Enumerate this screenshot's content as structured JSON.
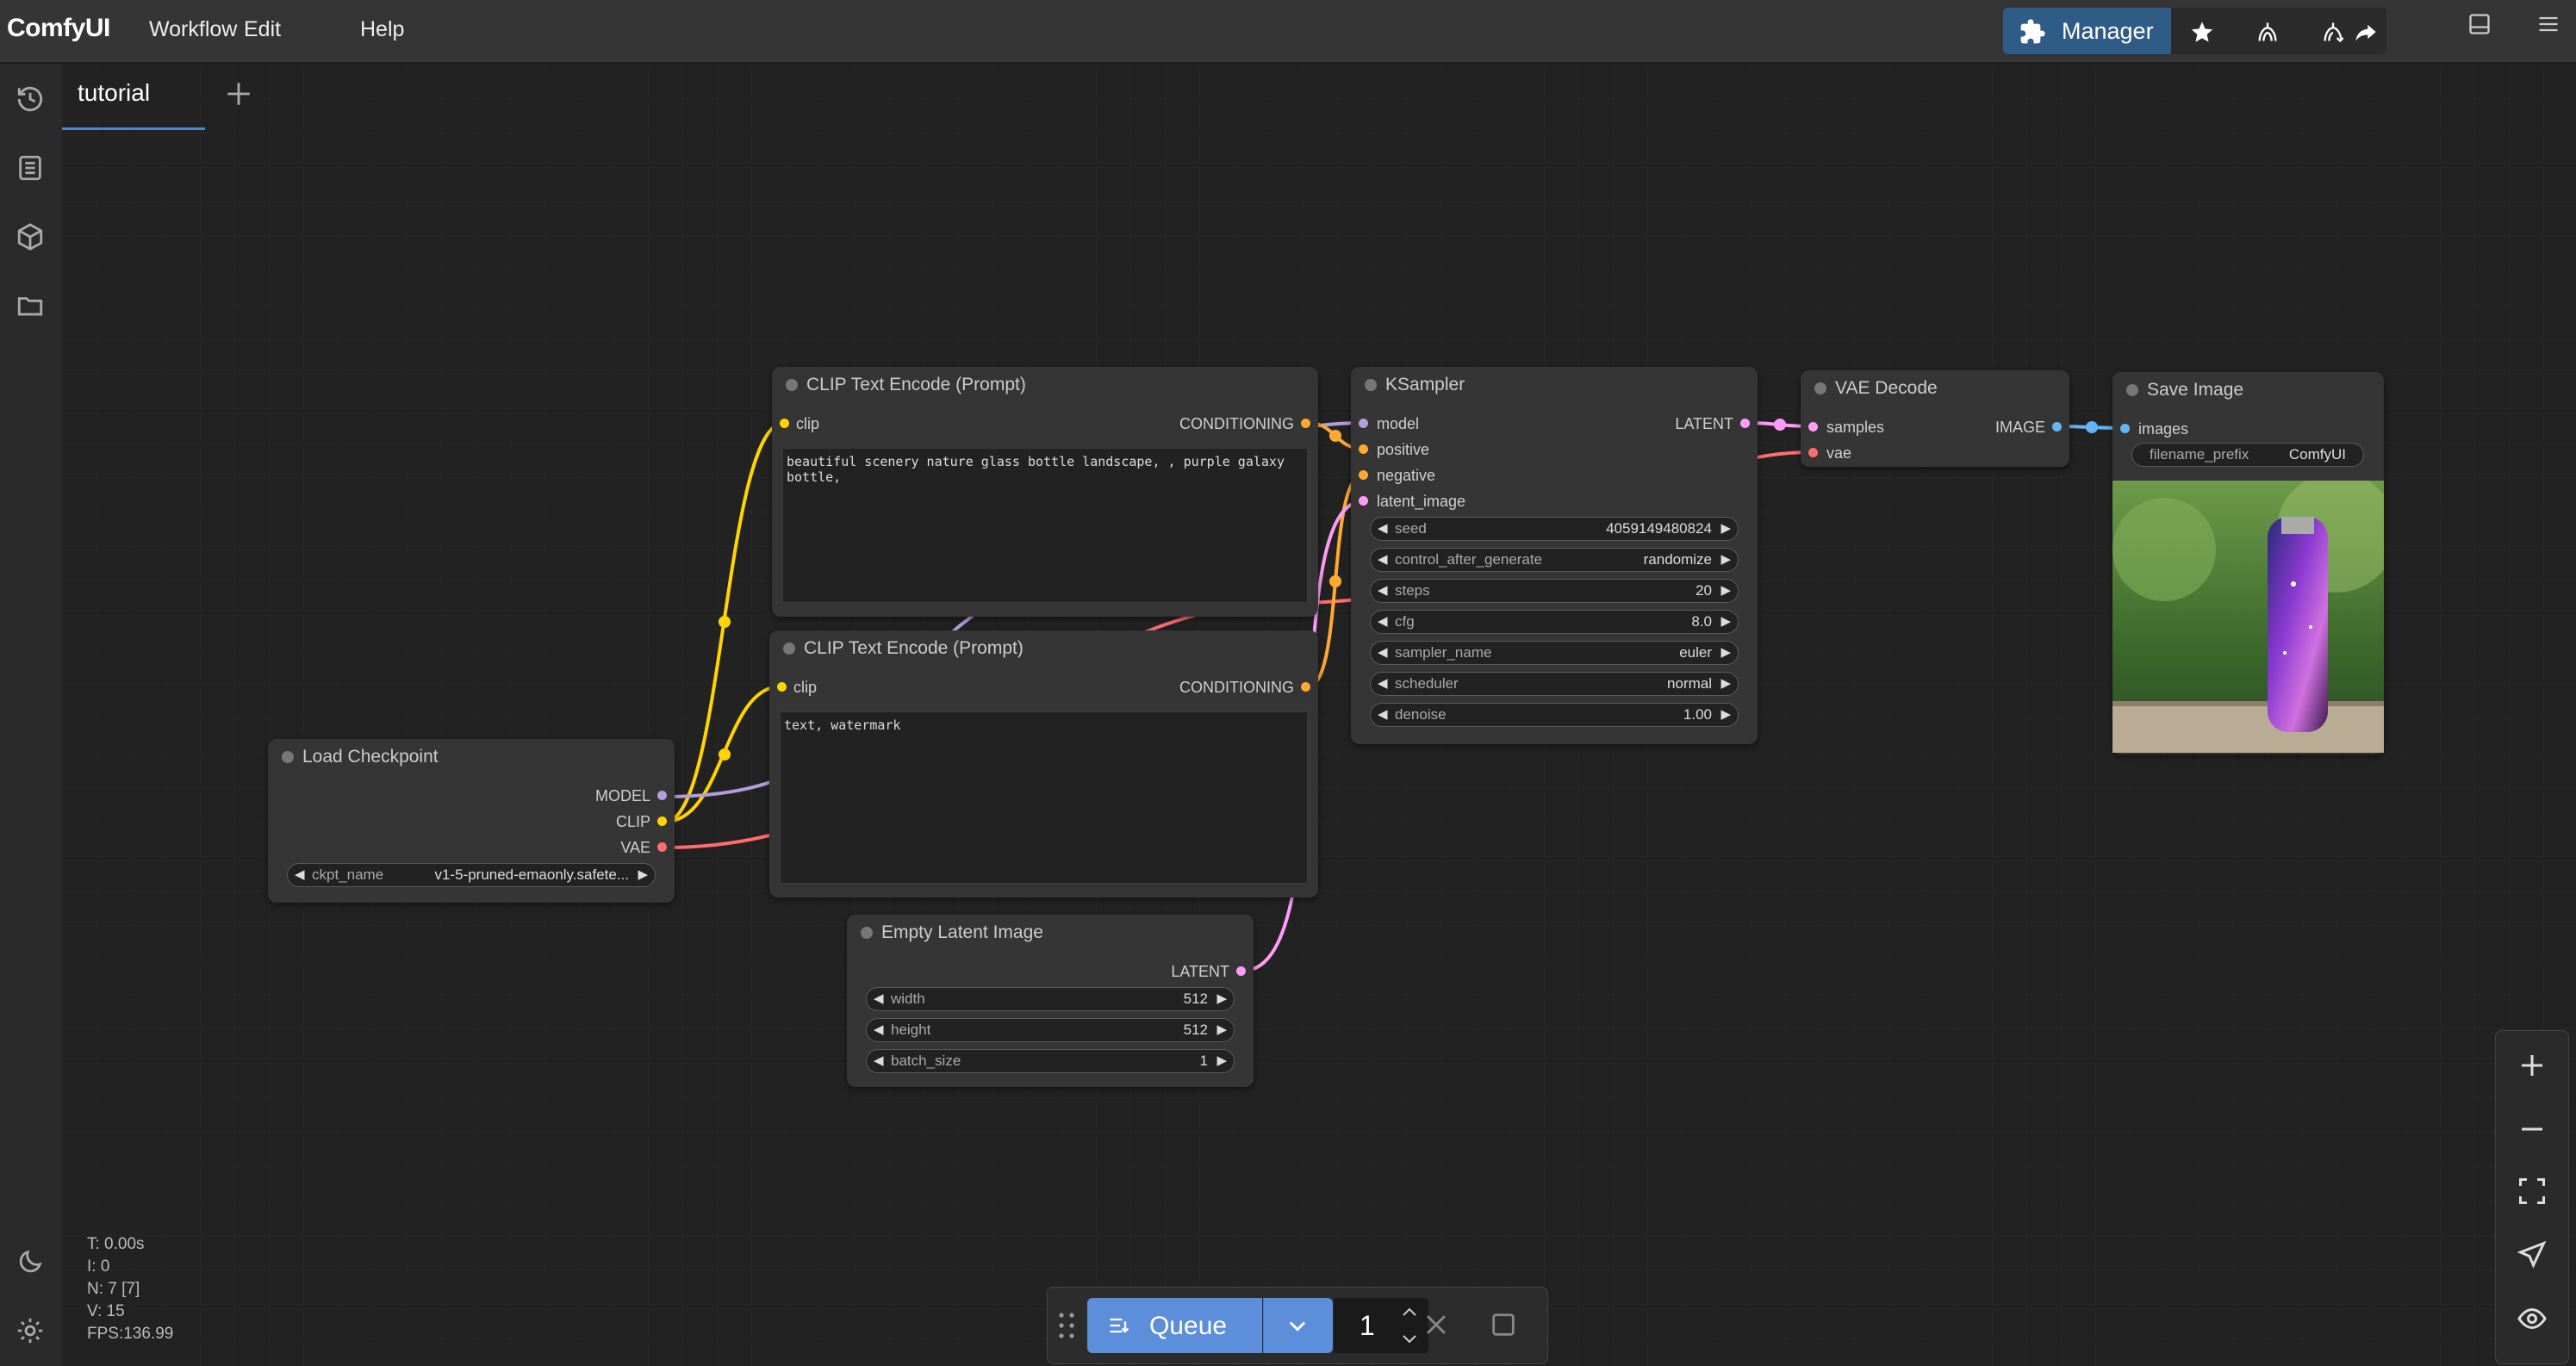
{
  "app": {
    "title": "ComfyUI"
  },
  "menu": {
    "workflow": "Workflow",
    "edit": "Edit",
    "help": "Help"
  },
  "toolbar": {
    "manager_label": "Manager"
  },
  "tabs": [
    {
      "label": "tutorial"
    }
  ],
  "nodes": {
    "clip_pos": {
      "title": "CLIP Text Encode (Prompt)",
      "input": "clip",
      "output": "CONDITIONING",
      "text": "beautiful scenery nature glass bottle landscape, , purple galaxy bottle,"
    },
    "clip_neg": {
      "title": "CLIP Text Encode (Prompt)",
      "input": "clip",
      "output": "CONDITIONING",
      "text": "text, watermark"
    },
    "ksampler": {
      "title": "KSampler",
      "inputs": [
        "model",
        "positive",
        "negative",
        "latent_image"
      ],
      "output": "LATENT",
      "widgets": [
        {
          "label": "seed",
          "value": "4059149480824"
        },
        {
          "label": "control_after_generate",
          "value": "randomize"
        },
        {
          "label": "steps",
          "value": "20"
        },
        {
          "label": "cfg",
          "value": "8.0"
        },
        {
          "label": "sampler_name",
          "value": "euler"
        },
        {
          "label": "scheduler",
          "value": "normal"
        },
        {
          "label": "denoise",
          "value": "1.00"
        }
      ]
    },
    "vae_decode": {
      "title": "VAE Decode",
      "inputs": [
        "samples",
        "vae"
      ],
      "output": "IMAGE"
    },
    "save_image": {
      "title": "Save Image",
      "input": "images",
      "widget": {
        "label": "filename_prefix",
        "value": "ComfyUI"
      }
    },
    "load_checkpoint": {
      "title": "Load Checkpoint",
      "outputs": [
        "MODEL",
        "CLIP",
        "VAE"
      ],
      "widget": {
        "label": "ckpt_name",
        "value": "v1-5-pruned-emaonly.safete..."
      }
    },
    "empty_latent": {
      "title": "Empty Latent Image",
      "output": "LATENT",
      "widgets": [
        {
          "label": "width",
          "value": "512"
        },
        {
          "label": "height",
          "value": "512"
        },
        {
          "label": "batch_size",
          "value": "1"
        }
      ]
    }
  },
  "stats": {
    "t": "T: 0.00s",
    "i": "I: 0",
    "n": "N: 7 [7]",
    "v": "V: 15",
    "fps": "FPS:136.99"
  },
  "queue": {
    "label": "Queue",
    "count": "1"
  },
  "colors": {
    "clip_link": "#ffd500",
    "model_link": "#b39ddb",
    "vae_link": "#ff6e6e",
    "conditioning_link": "#ffa931",
    "latent_link": "#ff9cf9",
    "image_link": "#64b5f6",
    "accent": "#2f5b87",
    "queue_button": "#5c8ed9"
  }
}
